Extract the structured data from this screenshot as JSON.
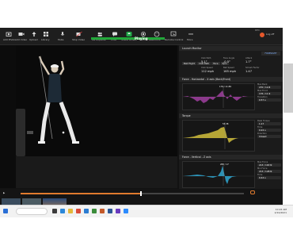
{
  "toolbar": {
    "buttons": [
      {
        "label": "Add Photo",
        "icon": "camera-icon"
      },
      {
        "label": "Add Video",
        "icon": "video-icon"
      },
      {
        "label": "Upload",
        "icon": "upload-icon"
      },
      {
        "label": "Library",
        "icon": "library-icon"
      },
      {
        "label": "Mute",
        "icon": "mic-icon"
      },
      {
        "label": "Stop Video",
        "icon": "video-off-icon"
      },
      {
        "label": "Participants",
        "icon": "people-icon"
      },
      {
        "label": "Chat",
        "icon": "chat-icon"
      },
      {
        "label": "Share Screen",
        "icon": "share-icon"
      },
      {
        "label": "Record",
        "icon": "record-icon"
      },
      {
        "label": "Reactions",
        "icon": "emoji-icon"
      },
      {
        "label": "Remote Control",
        "icon": "remote-icon"
      },
      {
        "label": "More",
        "icon": "more-icon"
      }
    ],
    "status_text": "Playing",
    "logout": "Log off",
    "recording": "REC"
  },
  "panel": {
    "launch": {
      "title": "Launch Monitor",
      "tabs": [
        "Ball Flight",
        "Club Path",
        "Face",
        "Spin",
        "Totals"
      ],
      "fields": [
        {
          "label": "Club Path",
          "value": "5.1°"
        },
        {
          "label": "Face Angle",
          "value": "-0.5°"
        },
        {
          "label": "Attack",
          "value": "1.7°"
        },
        {
          "label": "Club Speed",
          "value": "112 mph"
        },
        {
          "label": "Ball Speed",
          "value": "165 mph"
        },
        {
          "label": "Smash Factor",
          "value": "1.47"
        }
      ]
    },
    "force_horizontal": {
      "title": "Force - Horizontal - X axis (Back/Front)",
      "annotation": "179 / 11.89",
      "metrics": [
        {
          "label": "Max Back",
          "value": "270 / 12.8"
        },
        {
          "label": "Max Front",
          "value": "176 / 11.9"
        },
        {
          "label": "Transition",
          "value": "0.57 s"
        }
      ]
    },
    "torque": {
      "title": "Torque",
      "annotation": "53.38",
      "metrics": [
        {
          "label": "Peak Torque",
          "value": "1.17"
        },
        {
          "label": "Time",
          "value": "0.22 s"
        },
        {
          "label": "Direction",
          "value": "Closed"
        }
      ]
    },
    "force_vertical": {
      "title": "Force - Vertical - Z axis",
      "annotation": "283 / 17",
      "metrics": [
        {
          "label": "Max Force",
          "value": "213 / 163 N"
        },
        {
          "label": "Min Force",
          "value": "213 / 128 N"
        },
        {
          "label": "Time",
          "value": "0.44 s"
        }
      ]
    }
  },
  "timeline": {
    "progress": 0.54,
    "thumbnails": 3
  },
  "taskbar": {
    "time": "10:22 AM",
    "date": "2/10/2021"
  }
}
